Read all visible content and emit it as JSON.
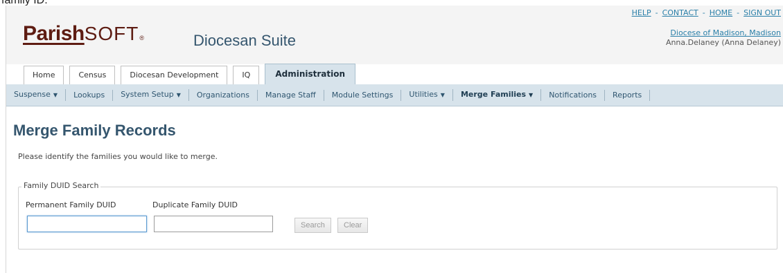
{
  "header": {
    "logo_bold": "Parish",
    "logo_light": "SOFT",
    "logo_reg": "®",
    "suite_title": "Diocesan Suite",
    "top_links": [
      "HELP",
      "CONTACT",
      "HOME",
      "SIGN OUT"
    ],
    "diocese": "Diocese of Madison, Madison",
    "user": "Anna.Delaney (Anna Delaney)",
    "brand_color": "#5e1c12",
    "accent_color": "#2a7fa8"
  },
  "tabs": [
    "Home",
    "Census",
    "Diocesan Development",
    "IQ",
    "Administration"
  ],
  "subnav": [
    {
      "label": "Suspense",
      "dropdown": true
    },
    {
      "label": "Lookups",
      "dropdown": false
    },
    {
      "label": "System Setup",
      "dropdown": true
    },
    {
      "label": "Organizations",
      "dropdown": false
    },
    {
      "label": "Manage Staff",
      "dropdown": false
    },
    {
      "label": "Module Settings",
      "dropdown": false
    },
    {
      "label": "Utilities",
      "dropdown": true
    },
    {
      "label": "Merge Families",
      "dropdown": true
    },
    {
      "label": "Notifications",
      "dropdown": false
    },
    {
      "label": "Reports",
      "dropdown": false
    }
  ],
  "caret": "▼",
  "main": {
    "title": "Merge Family Records",
    "instructions": "Please identify the families you would like to merge.",
    "fieldset_legend": "Family DUID Search",
    "permanent_label": "Permanent Family DUID",
    "permanent_value": "",
    "duplicate_label": "Duplicate Family DUID",
    "duplicate_value": "",
    "search_label": "Search",
    "clear_label": "Clear"
  },
  "page_caption": "family ID."
}
